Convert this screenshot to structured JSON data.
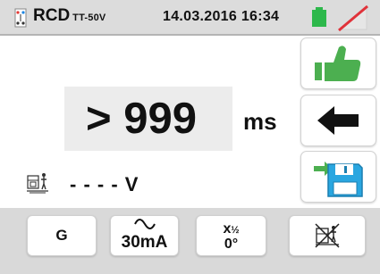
{
  "header": {
    "title": "RCD",
    "subtitle": "TT-50V",
    "datetime": "14.03.2016  16:34",
    "battery_color": "#2db84b",
    "signal_slash_color": "#e0323a"
  },
  "measurement": {
    "value": "> 999",
    "unit": "ms",
    "voltage_value": "- - - -",
    "voltage_unit": "V"
  },
  "right_buttons": [
    {
      "name": "ok-thumbs-up",
      "icon": "thumbs-up-icon",
      "color": "#4caf50"
    },
    {
      "name": "back",
      "icon": "arrow-left-icon"
    },
    {
      "name": "save",
      "icon": "save-to-memory-icon",
      "color": "#29a6e0"
    }
  ],
  "bottom_buttons": {
    "g_label": "G",
    "current_label": "30mA",
    "factor_label_x": "x",
    "factor_label_frac": "½",
    "phase_label": "0°"
  },
  "colors": {
    "topbar": "#dcdcdc",
    "bottombar": "#d9d9d9",
    "result_box": "#ececec"
  }
}
